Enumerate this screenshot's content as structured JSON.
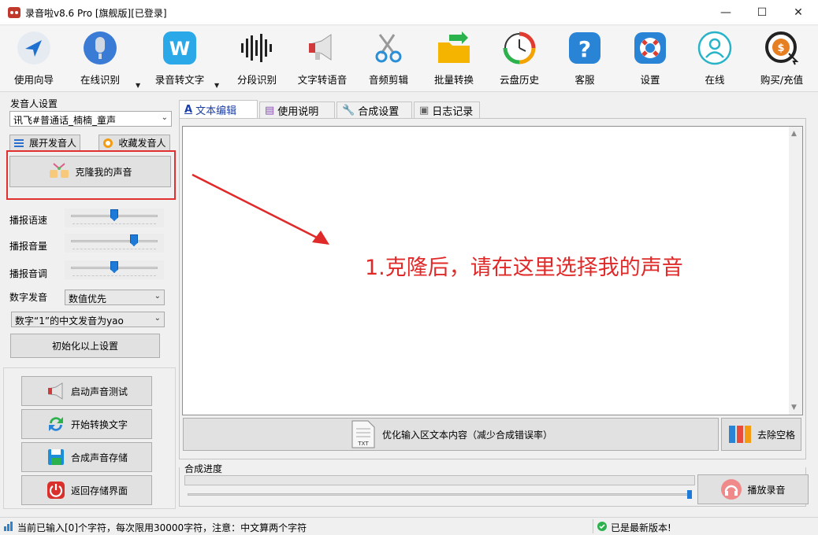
{
  "window": {
    "title": "录音啦v8.6 Pro [旗舰版][已登录]"
  },
  "toolbar": {
    "items": [
      {
        "label": "使用向导"
      },
      {
        "label": "在线识别"
      },
      {
        "label": "录音转文字"
      },
      {
        "label": "分段识别"
      },
      {
        "label": "文字转语音"
      },
      {
        "label": "音频剪辑"
      },
      {
        "label": "批量转换"
      },
      {
        "label": "云盘历史"
      },
      {
        "label": "客服"
      },
      {
        "label": "设置"
      },
      {
        "label": "在线"
      },
      {
        "label": "购买/充值"
      }
    ]
  },
  "left_panel": {
    "speaker_group_label": "发音人设置",
    "speaker_select": "讯飞#普通话_楠楠_童声",
    "expand_button": "展开发音人",
    "favorite_button": "收藏发音人",
    "clone_button": "克隆我的声音",
    "speed_label": "播报语速",
    "volume_label": "播报音量",
    "pitch_label": "播报音调",
    "speed_level": 0.5,
    "volume_level": 0.75,
    "pitch_level": 0.5,
    "digit_label": "数字发音",
    "digit_select": "数值优先",
    "one_pron_select": "数字“1”的中文发音为yao",
    "reset_button": "初始化以上设置",
    "test_button": "启动声音测试",
    "convert_button": "开始转换文字",
    "save_button": "合成声音存储",
    "return_button": "返回存储界面"
  },
  "tabs": [
    {
      "label": "文本编辑"
    },
    {
      "label": "使用说明"
    },
    {
      "label": "合成设置"
    },
    {
      "label": "日志记录"
    }
  ],
  "annotation": {
    "text": "1.克隆后，请在这里选择我的声音"
  },
  "bottom": {
    "optimize_button": "优化输入区文本内容（减少合成错误率）",
    "remove_spaces_button": "去除空格",
    "progress_label": "合成进度",
    "play_button": "播放录音"
  },
  "status": {
    "left": "当前已输入[0]个字符，每次限用30000字符，注意：中文算两个字符",
    "right": "已是最新版本!"
  },
  "colors": {
    "accent": "#1e7ad8",
    "annotation": "#e02a2a"
  }
}
